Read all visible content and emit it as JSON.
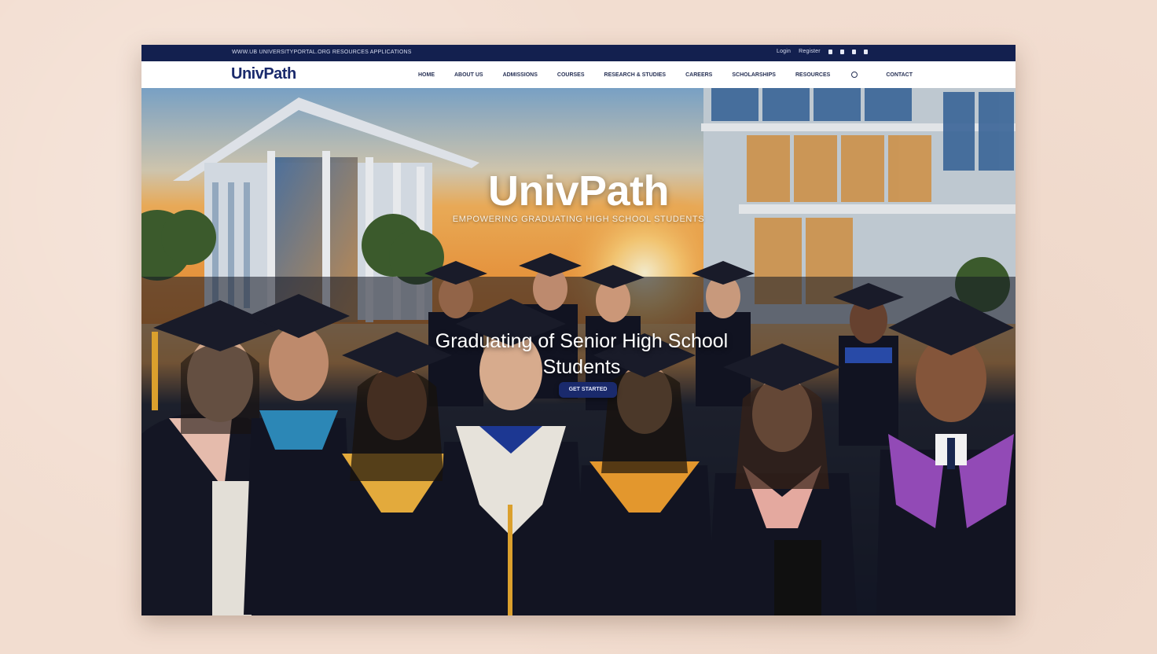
{
  "utility_bar": {
    "left_text": "WWW.UB UNIVERSITYPORTAL.ORG  RESOURCES  APPLICATIONS",
    "links": [
      "Login",
      "Register"
    ],
    "icons": [
      "facebook-icon",
      "twitter-icon",
      "instagram-icon",
      "youtube-icon"
    ]
  },
  "nav": {
    "logo": "UnivPath",
    "items": [
      "HOME",
      "ABOUT US",
      "ADMISSIONS",
      "COURSES",
      "RESEARCH & STUDIES",
      "CAREERS",
      "SCHOLARSHIPS",
      "RESOURCES",
      "CONTACT"
    ],
    "search_icon": "search-icon"
  },
  "hero": {
    "title": "UnivPath",
    "tagline": "EMPOWERING GRADUATING HIGH SCHOOL STUDENTS",
    "subtitle": "Graduating of Senior High School Students",
    "cta": "GET STARTED"
  },
  "colors": {
    "brand": "#1a2a6c",
    "utility_bar": "#13204f",
    "accent": "#f0a020"
  }
}
